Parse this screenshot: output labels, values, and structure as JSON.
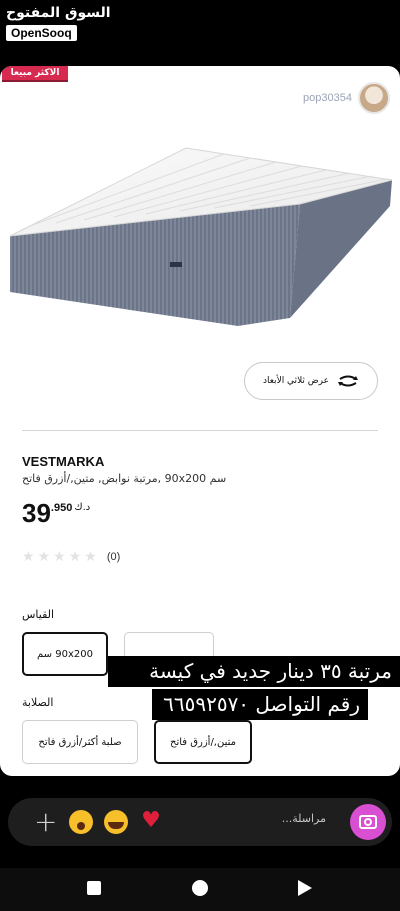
{
  "brand": {
    "arabic": "السوق المفتوح",
    "english": "OpenSooq"
  },
  "badge": {
    "label": "الاكثر مبيعا"
  },
  "seller": {
    "name": "pop30354"
  },
  "viewer": {
    "label": "عرض ثلاثي الأبعاد"
  },
  "product": {
    "title": "VESTMARKA",
    "description": "سم 90x200 ,مرتبة نوابض, متين,/أزرق فاتح",
    "price_int": "39",
    "price_dec": ".950",
    "currency": "د.ك",
    "rating_count": "(0)",
    "stars_total": 5,
    "stars_filled": 0
  },
  "size_section": {
    "label": "القياس",
    "options": [
      "90x200 سم",
      ""
    ],
    "selected_index": 0
  },
  "firmness_section": {
    "label": "الصلابة",
    "options": [
      "صلبة أكثر/أزرق فاتح",
      "متين,/أزرق فاتح"
    ],
    "selected_index": 1
  },
  "caption": {
    "line1": "مرتبة ٣٥ دينار جديد في كيسة",
    "line2": "رقم التواصل ٦٦٥٩٢٥٧٠"
  },
  "reply": {
    "placeholder": "مراسلة...",
    "emojis": [
      "open-mouth-emoji",
      "laughing-tears-emoji",
      "red-heart-emoji"
    ]
  },
  "colors": {
    "badge": "#d62a50",
    "camera": "#d94fd1",
    "heart": "#e0203a"
  }
}
